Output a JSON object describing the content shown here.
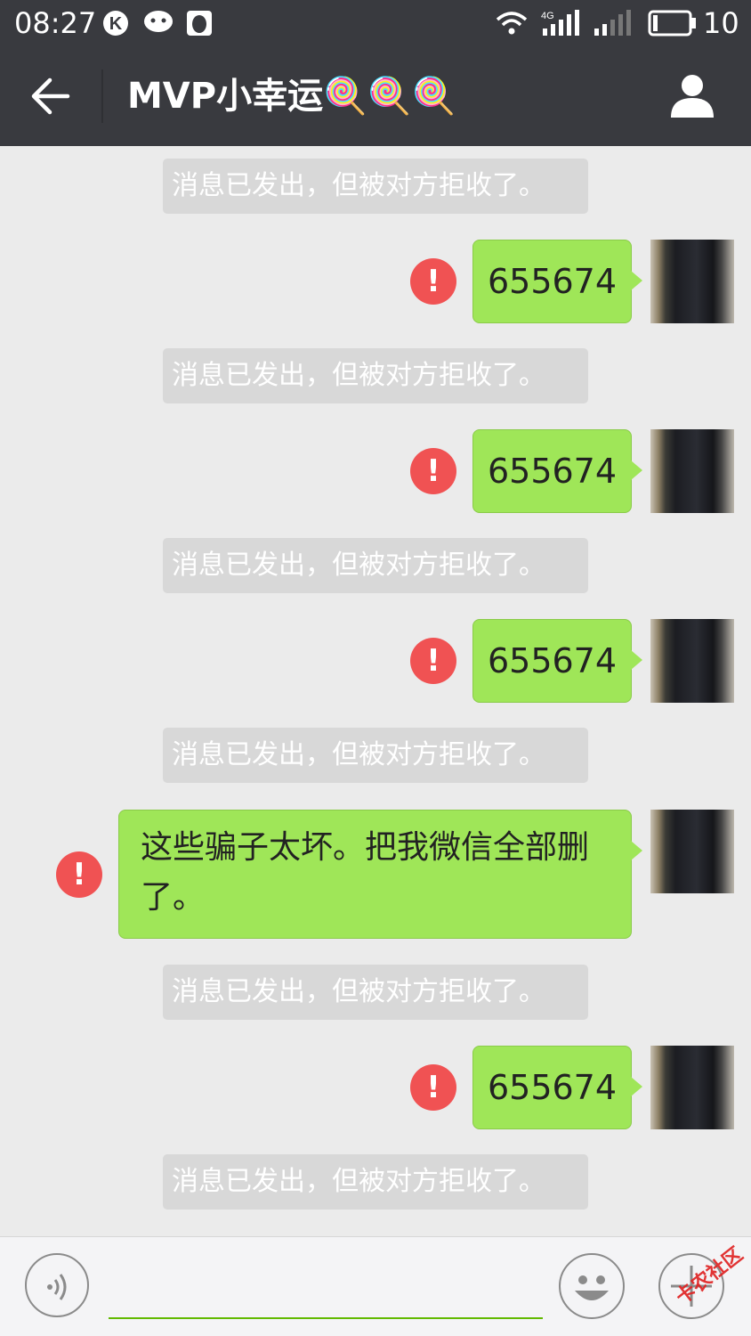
{
  "status_bar": {
    "time": "08:27",
    "network": "4G",
    "battery": "10"
  },
  "header": {
    "title": "MVP小幸运🍭🍭🍭"
  },
  "messages": [
    {
      "kind": "notice",
      "text": "消息已发出，但被对方拒收了。"
    },
    {
      "kind": "out",
      "text": "655674",
      "status": "failed"
    },
    {
      "kind": "notice",
      "text": "消息已发出，但被对方拒收了。"
    },
    {
      "kind": "out",
      "text": "655674",
      "status": "failed"
    },
    {
      "kind": "notice",
      "text": "消息已发出，但被对方拒收了。"
    },
    {
      "kind": "out",
      "text": "655674",
      "status": "failed"
    },
    {
      "kind": "notice",
      "text": "消息已发出，但被对方拒收了。"
    },
    {
      "kind": "out",
      "text": "这些骗子太坏。把我微信全部删了。",
      "status": "failed"
    },
    {
      "kind": "notice",
      "text": "消息已发出，但被对方拒收了。"
    },
    {
      "kind": "out",
      "text": "655674",
      "status": "failed"
    },
    {
      "kind": "notice",
      "text": "消息已发出，但被对方拒收了。"
    }
  ],
  "composer": {
    "input_value": "",
    "watermark": "卡农社区"
  },
  "colors": {
    "header": "#393a3f",
    "bubble": "#9fe658",
    "error": "#f05253",
    "background": "#ebebeb"
  }
}
